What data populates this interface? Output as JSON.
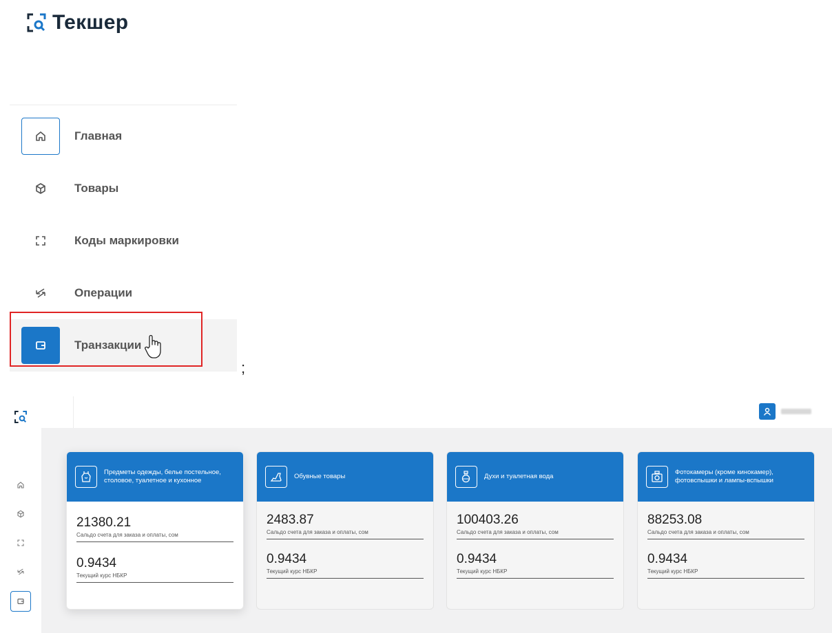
{
  "brand": {
    "name": "Текшер"
  },
  "nav": {
    "items": [
      {
        "label": "Главная",
        "icon": "home-icon"
      },
      {
        "label": "Товары",
        "icon": "box-icon"
      },
      {
        "label": "Коды маркировки",
        "icon": "scan-icon"
      },
      {
        "label": "Операции",
        "icon": "arrows-icon"
      },
      {
        "label": "Транзакции",
        "icon": "wallet-icon"
      }
    ]
  },
  "separator": ";",
  "cards": [
    {
      "title": "Предметы одежды, белье постельное, столовое, туалетное и кухонное",
      "icon": "dress-icon",
      "balance": "21380.21",
      "balance_label": "Сальдо счета для заказа и оплаты, сом",
      "rate": "0.9434",
      "rate_label": "Текущий курс НБКР"
    },
    {
      "title": "Обувные товары",
      "icon": "shoe-icon",
      "balance": "2483.87",
      "balance_label": "Сальдо счета для заказа и оплаты, сом",
      "rate": "0.9434",
      "rate_label": "Текущий курс НБКР"
    },
    {
      "title": "Духи и туалетная вода",
      "icon": "perfume-icon",
      "balance": "100403.26",
      "balance_label": "Сальдо счета для заказа и оплаты, сом",
      "rate": "0.9434",
      "rate_label": "Текущий курс НБКР"
    },
    {
      "title": "Фотокамеры (кроме кинокамер), фотовспышки и лампы-вспышки",
      "icon": "camera-icon",
      "balance": "88253.08",
      "balance_label": "Сальдо счета для заказа и оплаты, сом",
      "rate": "0.9434",
      "rate_label": "Текущий курс НБКР"
    }
  ],
  "colors": {
    "accent": "#1b77c8",
    "highlight": "#e02424"
  }
}
